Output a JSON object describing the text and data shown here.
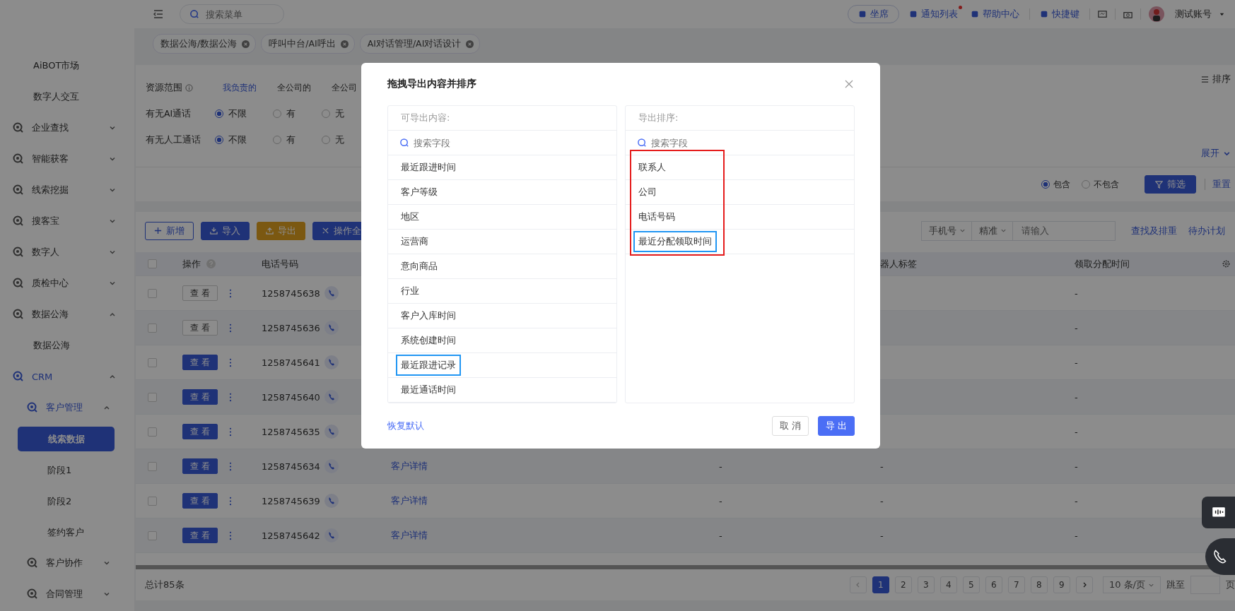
{
  "topbar": {
    "search": {
      "placeholder": "搜索菜单"
    },
    "actions": [
      {
        "label": "坐席",
        "kind": "pill",
        "badge": false
      },
      {
        "label": "通知列表",
        "kind": "link",
        "badge": true
      },
      {
        "label": "帮助中心",
        "kind": "link",
        "badge": false
      },
      {
        "label": "快捷键",
        "kind": "link",
        "badge": false
      }
    ],
    "user": "测试账号"
  },
  "tabs": [
    {
      "label": "数据公海/数据公海"
    },
    {
      "label": "呼叫中台/AI呼出"
    },
    {
      "label": "AI对话管理/AI对话设计"
    }
  ],
  "sidebar": {
    "items": [
      {
        "label": "AiBOT市场",
        "kind": "link",
        "selected": false
      },
      {
        "label": "数字人交互",
        "kind": "link",
        "selected": false
      },
      {
        "label": "企业查找",
        "kind": "group",
        "expanded": false
      },
      {
        "label": "智能获客",
        "kind": "group",
        "expanded": false
      },
      {
        "label": "线索挖掘",
        "kind": "group",
        "expanded": false
      },
      {
        "label": "搜客宝",
        "kind": "group",
        "expanded": false
      },
      {
        "label": "数字人",
        "kind": "group",
        "expanded": false
      },
      {
        "label": "质检中心",
        "kind": "group",
        "expanded": false
      },
      {
        "label": "数据公海",
        "kind": "group",
        "expanded": true,
        "children": [
          {
            "label": "数据公海",
            "kind": "link",
            "selected": false
          }
        ]
      },
      {
        "label": "CRM",
        "kind": "group",
        "expanded": true,
        "children": [
          {
            "label": "客户管理",
            "kind": "group",
            "expanded": true,
            "children": [
              {
                "label": "线索数据",
                "kind": "link",
                "selected": true
              },
              {
                "label": "阶段1",
                "kind": "link",
                "selected": false
              },
              {
                "label": "阶段2",
                "kind": "link",
                "selected": false
              },
              {
                "label": "签约客户",
                "kind": "link",
                "selected": false
              }
            ]
          },
          {
            "label": "客户协作",
            "kind": "group",
            "expanded": false
          },
          {
            "label": "合同管理",
            "kind": "group",
            "expanded": false
          }
        ]
      }
    ]
  },
  "filters": [
    {
      "label": "资源范围",
      "kind": "tabs",
      "options": [
        {
          "label": "我负责的",
          "selected": true
        },
        {
          "label": "全公司的",
          "selected": false
        },
        {
          "label": "全公司",
          "selected": false
        }
      ]
    },
    {
      "label": "有无AI通话",
      "kind": "radio",
      "options": [
        {
          "label": "不限",
          "selected": true
        },
        {
          "label": "有",
          "selected": false
        },
        {
          "label": "无",
          "selected": false
        }
      ]
    },
    {
      "label": "有无人工通话",
      "kind": "radio",
      "options": [
        {
          "label": "不限",
          "selected": true
        },
        {
          "label": "有",
          "selected": false
        },
        {
          "label": "无",
          "selected": false
        }
      ]
    }
  ],
  "sort_link": "排序",
  "expand_link": "展开",
  "match": [
    {
      "label": "包含",
      "selected": true
    },
    {
      "label": "不包含",
      "selected": false
    }
  ],
  "filter_button": "筛选",
  "reset_link": "重置",
  "toolbar": {
    "buttons": [
      {
        "label": "新增",
        "kind": "outline"
      },
      {
        "label": "导入",
        "kind": "primary"
      },
      {
        "label": "导出",
        "kind": "warning"
      },
      {
        "label": "操作全",
        "kind": "primary"
      }
    ],
    "search_type": "手机号",
    "match_mode": "精准",
    "search": {
      "placeholder": "请输入"
    },
    "links": [
      "查找及排重",
      "待办计划"
    ]
  },
  "table": {
    "select_all": false,
    "columns": [
      "操作",
      "电话号码",
      "",
      "",
      "器人标签",
      "领取分配时间"
    ],
    "rows": [
      {
        "checked": false,
        "view": "查 看",
        "kind": "outline",
        "phone": "1258745638",
        "cells": [
          "",
          "",
          "",
          "-"
        ]
      },
      {
        "checked": false,
        "view": "查 看",
        "kind": "outline",
        "phone": "1258745636",
        "cells": [
          "",
          "",
          "",
          "-"
        ]
      },
      {
        "checked": false,
        "view": "查 看",
        "kind": "solid",
        "phone": "1258745641",
        "cells": [
          "",
          "",
          "",
          "-"
        ]
      },
      {
        "checked": false,
        "view": "查 看",
        "kind": "solid",
        "phone": "1258745640",
        "cells": [
          "",
          "",
          "",
          "-"
        ]
      },
      {
        "checked": false,
        "view": "查 看",
        "kind": "solid",
        "phone": "1258745635",
        "cells": [
          "",
          "",
          "",
          "-"
        ]
      },
      {
        "checked": false,
        "view": "查 看",
        "kind": "solid",
        "phone": "1258745634",
        "cells": [
          "客户详情",
          "-",
          "-",
          "-"
        ]
      },
      {
        "checked": false,
        "view": "查 看",
        "kind": "solid",
        "phone": "1258745639",
        "cells": [
          "客户详情",
          "-",
          "-",
          "-"
        ]
      },
      {
        "checked": false,
        "view": "查 看",
        "kind": "solid",
        "phone": "1258745642",
        "cells": [
          "客户详情",
          "-",
          "-",
          "-"
        ]
      }
    ]
  },
  "total": "总计85条",
  "pagination": {
    "pages": [
      {
        "label": "1",
        "selected": true
      },
      {
        "label": "2",
        "selected": false
      },
      {
        "label": "3",
        "selected": false
      },
      {
        "label": "4",
        "selected": false
      },
      {
        "label": "5",
        "selected": false
      },
      {
        "label": "6",
        "selected": false
      },
      {
        "label": "7",
        "selected": false
      },
      {
        "label": "8",
        "selected": false
      },
      {
        "label": "9",
        "selected": false
      }
    ],
    "page_size": "10 条/页",
    "jump_label": "跳至",
    "page_suffix": "页"
  },
  "dialog": {
    "title": "拖拽导出内容并排序",
    "panels": [
      {
        "header": "可导出内容:",
        "search": {
          "placeholder": "搜索字段"
        },
        "framed": false,
        "items": [
          {
            "label": "最近跟进时间",
            "outlined": false
          },
          {
            "label": "客户等级",
            "outlined": false
          },
          {
            "label": "地区",
            "outlined": false
          },
          {
            "label": "运营商",
            "outlined": false
          },
          {
            "label": "意向商品",
            "outlined": false
          },
          {
            "label": "行业",
            "outlined": false
          },
          {
            "label": "客户入库时间",
            "outlined": false
          },
          {
            "label": "系统创建时间",
            "outlined": false
          },
          {
            "label": "最近跟进记录",
            "outlined": true
          },
          {
            "label": "最近通话时间",
            "outlined": false
          }
        ]
      },
      {
        "header": "导出排序:",
        "search": {
          "placeholder": "搜索字段"
        },
        "framed": true,
        "items": [
          {
            "label": "联系人",
            "outlined": false
          },
          {
            "label": "公司",
            "outlined": false
          },
          {
            "label": "电话号码",
            "outlined": false
          },
          {
            "label": "最近分配领取时间",
            "outlined": true
          }
        ]
      }
    ],
    "reset_link": "恢复默认",
    "buttons": [
      {
        "label": "取 消",
        "kind": "default"
      },
      {
        "label": "导 出",
        "kind": "primary"
      }
    ]
  }
}
